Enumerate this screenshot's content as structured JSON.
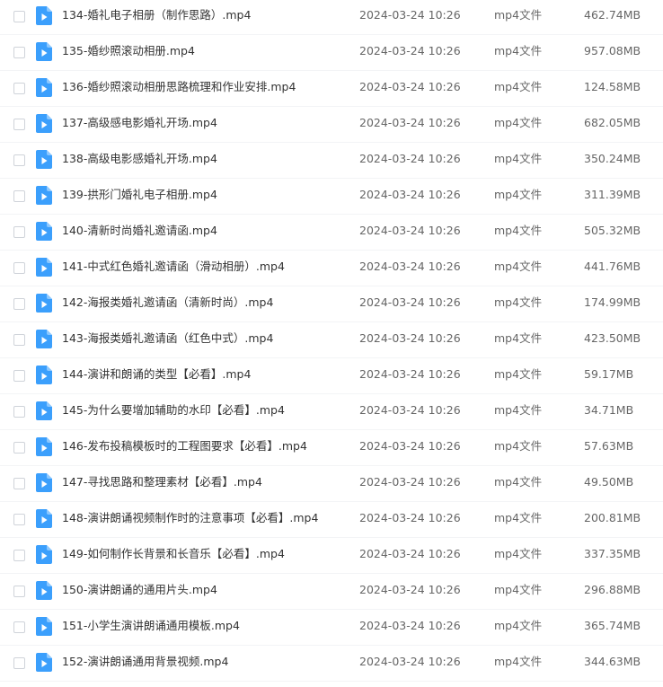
{
  "accent_color": "#3b9ffc",
  "icon": "video-file-icon",
  "files": [
    {
      "name": "134-婚礼电子相册（制作思路）.mp4",
      "date": "2024-03-24 10:26",
      "type": "mp4文件",
      "size": "462.74MB"
    },
    {
      "name": "135-婚纱照滚动相册.mp4",
      "date": "2024-03-24 10:26",
      "type": "mp4文件",
      "size": "957.08MB"
    },
    {
      "name": "136-婚纱照滚动相册思路梳理和作业安排.mp4",
      "date": "2024-03-24 10:26",
      "type": "mp4文件",
      "size": "124.58MB"
    },
    {
      "name": "137-高级感电影婚礼开场.mp4",
      "date": "2024-03-24 10:26",
      "type": "mp4文件",
      "size": "682.05MB"
    },
    {
      "name": "138-高级电影感婚礼开场.mp4",
      "date": "2024-03-24 10:26",
      "type": "mp4文件",
      "size": "350.24MB"
    },
    {
      "name": "139-拱形门婚礼电子相册.mp4",
      "date": "2024-03-24 10:26",
      "type": "mp4文件",
      "size": "311.39MB"
    },
    {
      "name": "140-清新时尚婚礼邀请函.mp4",
      "date": "2024-03-24 10:26",
      "type": "mp4文件",
      "size": "505.32MB"
    },
    {
      "name": "141-中式红色婚礼邀请函（滑动相册）.mp4",
      "date": "2024-03-24 10:26",
      "type": "mp4文件",
      "size": "441.76MB"
    },
    {
      "name": "142-海报类婚礼邀请函（清新时尚）.mp4",
      "date": "2024-03-24 10:26",
      "type": "mp4文件",
      "size": "174.99MB"
    },
    {
      "name": "143-海报类婚礼邀请函（红色中式）.mp4",
      "date": "2024-03-24 10:26",
      "type": "mp4文件",
      "size": "423.50MB"
    },
    {
      "name": "144-演讲和朗诵的类型【必看】.mp4",
      "date": "2024-03-24 10:26",
      "type": "mp4文件",
      "size": "59.17MB"
    },
    {
      "name": "145-为什么要增加辅助的水印【必看】.mp4",
      "date": "2024-03-24 10:26",
      "type": "mp4文件",
      "size": "34.71MB"
    },
    {
      "name": "146-发布投稿模板时的工程图要求【必看】.mp4",
      "date": "2024-03-24 10:26",
      "type": "mp4文件",
      "size": "57.63MB"
    },
    {
      "name": "147-寻找思路和整理素材【必看】.mp4",
      "date": "2024-03-24 10:26",
      "type": "mp4文件",
      "size": "49.50MB"
    },
    {
      "name": "148-演讲朗诵视频制作时的注意事项【必看】.mp4",
      "date": "2024-03-24 10:26",
      "type": "mp4文件",
      "size": "200.81MB"
    },
    {
      "name": "149-如何制作长背景和长音乐【必看】.mp4",
      "date": "2024-03-24 10:26",
      "type": "mp4文件",
      "size": "337.35MB"
    },
    {
      "name": "150-演讲朗诵的通用片头.mp4",
      "date": "2024-03-24 10:26",
      "type": "mp4文件",
      "size": "296.88MB"
    },
    {
      "name": "151-小学生演讲朗诵通用模板.mp4",
      "date": "2024-03-24 10:26",
      "type": "mp4文件",
      "size": "365.74MB"
    },
    {
      "name": "152-演讲朗诵通用背景视频.mp4",
      "date": "2024-03-24 10:26",
      "type": "mp4文件",
      "size": "344.63MB"
    }
  ]
}
